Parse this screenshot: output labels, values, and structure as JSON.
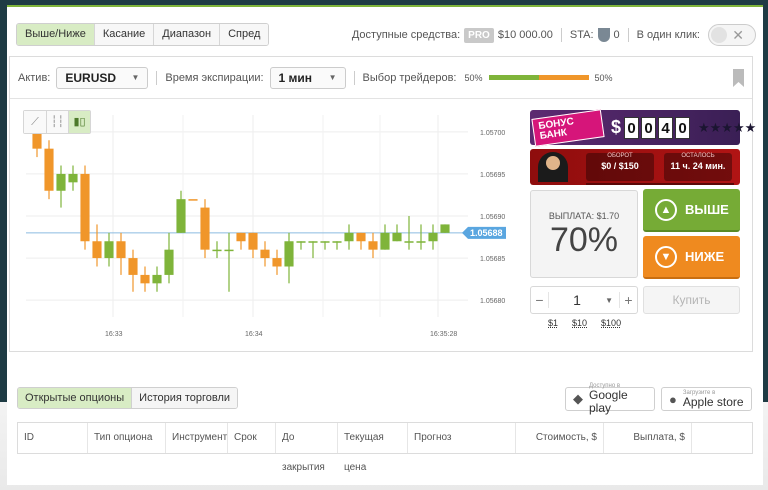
{
  "top_tabs": [
    "Выше/Ниже",
    "Касание",
    "Диапазон",
    "Спред"
  ],
  "topbar": {
    "funds_label": "Доступные средства:",
    "pro_badge": "PRO",
    "funds_value": "$10 000.00",
    "sta_label": "STA:",
    "sta_value": "0",
    "one_click_label": "В один клик:"
  },
  "options": {
    "asset_label": "Актив:",
    "asset_value": "EURUSD",
    "expiry_label": "Время экспирации:",
    "expiry_value": "1 мин",
    "traders_label": "Выбор трейдеров:",
    "traders_left": "50%",
    "traders_right": "50%"
  },
  "chart_data": {
    "type": "candlestick",
    "y_ticks": [
      "1.05700",
      "1.05695",
      "1.05690",
      "1.05685",
      "1.05680"
    ],
    "x_ticks": [
      "16:33",
      "16:34",
      "16:35:28"
    ],
    "current_price": "1.05688",
    "candles": [
      {
        "o": 1.057,
        "c": 1.05698,
        "h": 1.05701,
        "l": 1.05697,
        "color": "down"
      },
      {
        "o": 1.05698,
        "c": 1.05693,
        "h": 1.05699,
        "l": 1.05692,
        "color": "down"
      },
      {
        "o": 1.05693,
        "c": 1.05695,
        "h": 1.05696,
        "l": 1.05691,
        "color": "up"
      },
      {
        "o": 1.05695,
        "c": 1.05694,
        "h": 1.05696,
        "l": 1.05693,
        "color": "up"
      },
      {
        "o": 1.05695,
        "c": 1.05687,
        "h": 1.05696,
        "l": 1.05686,
        "color": "down"
      },
      {
        "o": 1.05687,
        "c": 1.05685,
        "h": 1.05689,
        "l": 1.05684,
        "color": "down"
      },
      {
        "o": 1.05685,
        "c": 1.05687,
        "h": 1.05688,
        "l": 1.05684,
        "color": "up"
      },
      {
        "o": 1.05687,
        "c": 1.05685,
        "h": 1.05688,
        "l": 1.05683,
        "color": "down"
      },
      {
        "o": 1.05685,
        "c": 1.05683,
        "h": 1.05686,
        "l": 1.05681,
        "color": "down"
      },
      {
        "o": 1.05683,
        "c": 1.05682,
        "h": 1.05684,
        "l": 1.05681,
        "color": "down"
      },
      {
        "o": 1.05682,
        "c": 1.05683,
        "h": 1.05684,
        "l": 1.05681,
        "color": "up"
      },
      {
        "o": 1.05683,
        "c": 1.05686,
        "h": 1.05688,
        "l": 1.05682,
        "color": "up"
      },
      {
        "o": 1.05688,
        "c": 1.05692,
        "h": 1.05693,
        "l": 1.05688,
        "color": "up"
      },
      {
        "o": 1.05692,
        "c": 1.05692,
        "h": 1.05692,
        "l": 1.05692,
        "color": "down"
      },
      {
        "o": 1.05691,
        "c": 1.05686,
        "h": 1.05692,
        "l": 1.05685,
        "color": "down"
      },
      {
        "o": 1.05686,
        "c": 1.05686,
        "h": 1.05687,
        "l": 1.05685,
        "color": "up"
      },
      {
        "o": 1.05686,
        "c": 1.05686,
        "h": 1.05688,
        "l": 1.05681,
        "color": "up"
      },
      {
        "o": 1.05688,
        "c": 1.05687,
        "h": 1.05688,
        "l": 1.05686,
        "color": "down"
      },
      {
        "o": 1.05688,
        "c": 1.05686,
        "h": 1.05688,
        "l": 1.05685,
        "color": "down"
      },
      {
        "o": 1.05686,
        "c": 1.05685,
        "h": 1.05687,
        "l": 1.05684,
        "color": "down"
      },
      {
        "o": 1.05685,
        "c": 1.05684,
        "h": 1.05686,
        "l": 1.05683,
        "color": "down"
      },
      {
        "o": 1.05684,
        "c": 1.05687,
        "h": 1.05688,
        "l": 1.05682,
        "color": "up"
      },
      {
        "o": 1.05687,
        "c": 1.05687,
        "h": 1.05687,
        "l": 1.05686,
        "color": "up"
      },
      {
        "o": 1.05687,
        "c": 1.05687,
        "h": 1.05687,
        "l": 1.05685,
        "color": "up"
      },
      {
        "o": 1.05687,
        "c": 1.05687,
        "h": 1.05687,
        "l": 1.05686,
        "color": "up"
      },
      {
        "o": 1.05687,
        "c": 1.05687,
        "h": 1.05687,
        "l": 1.05686,
        "color": "up"
      },
      {
        "o": 1.05687,
        "c": 1.05688,
        "h": 1.05689,
        "l": 1.05686,
        "color": "up"
      },
      {
        "o": 1.05688,
        "c": 1.05687,
        "h": 1.05688,
        "l": 1.05686,
        "color": "down"
      },
      {
        "o": 1.05687,
        "c": 1.05686,
        "h": 1.05688,
        "l": 1.05685,
        "color": "down"
      },
      {
        "o": 1.05686,
        "c": 1.05688,
        "h": 1.05689,
        "l": 1.05686,
        "color": "up"
      },
      {
        "o": 1.05688,
        "c": 1.05687,
        "h": 1.05689,
        "l": 1.05687,
        "color": "up"
      },
      {
        "o": 1.05687,
        "c": 1.05687,
        "h": 1.0569,
        "l": 1.05686,
        "color": "up"
      },
      {
        "o": 1.05687,
        "c": 1.05687,
        "h": 1.05689,
        "l": 1.05686,
        "color": "up"
      },
      {
        "o": 1.05687,
        "c": 1.05688,
        "h": 1.05689,
        "l": 1.05686,
        "color": "up"
      },
      {
        "o": 1.05688,
        "c": 1.05689,
        "h": 1.05689,
        "l": 1.05688,
        "color": "up"
      }
    ]
  },
  "bonus": {
    "logo": "БОНУС БАНК",
    "dollar": "$",
    "digits": [
      "0",
      "0",
      "4",
      "0"
    ],
    "stars": "★★★★★"
  },
  "vip": {
    "turnover_label": "ОБОРОТ",
    "turnover_value": "$0 / $150",
    "left_label": "ОСТАЛОСЬ",
    "left_value": "11 ч. 24 мин."
  },
  "trade": {
    "payout_label": "ВЫПЛАТА: $1.70",
    "payout_pct": "70%",
    "up_label": "ВЫШЕ",
    "down_label": "НИЖЕ",
    "amount": "1",
    "minus": "−",
    "plus": "+",
    "buy_label": "Купить",
    "quick_amounts": [
      "$1",
      "$10",
      "$100"
    ]
  },
  "bottom": {
    "tabs": [
      "Открытые опционы",
      "История торговли"
    ],
    "google_small": "Доступно в",
    "google_big": "Google play",
    "apple_small": "Загрузите в",
    "apple_big": "Apple store",
    "columns": [
      "ID",
      "Тип опциона",
      "Инструмент",
      "Срок",
      "До закрытия",
      "Текущая цена",
      "Прогноз",
      "Стоимость, $",
      "Выплата, $"
    ]
  },
  "colors": {
    "accent_green": "#7fb43a",
    "accent_orange": "#ef8a1f",
    "up_candle": "#7fb43a",
    "down_candle": "#f0962a",
    "price_tag": "#5aa6e0"
  }
}
